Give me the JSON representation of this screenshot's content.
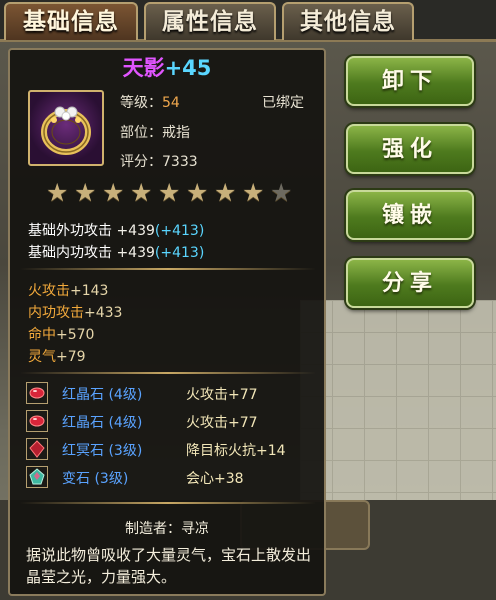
{
  "tabs": [
    {
      "label": "基础信息",
      "active": true
    },
    {
      "label": "属性信息",
      "active": false
    },
    {
      "label": "其他信息",
      "active": false
    }
  ],
  "item": {
    "name_base": "天影",
    "name_plus": "+45",
    "icon": "gold-ring-icon",
    "level_label": "等级：",
    "level_value": "54",
    "bound": "已绑定",
    "slot": "部位：戒指",
    "score": "评分：7333",
    "stars_total": 9,
    "stars_filled": 8
  },
  "base_stats": [
    {
      "label": "基础外功攻击",
      "value": "+439",
      "bonus": "(+413)"
    },
    {
      "label": "基础内功攻击",
      "value": "+439",
      "bonus": "(+413)"
    }
  ],
  "extra_attrs": [
    {
      "label": "火攻击",
      "value": "+143"
    },
    {
      "label": "内功攻击",
      "value": "+433"
    },
    {
      "label": "命中",
      "value": "+570"
    },
    {
      "label": "灵气",
      "value": "+79"
    }
  ],
  "gems": [
    {
      "name": "红晶石 (4级)",
      "effect": "火攻击+77",
      "icon": "red-crystal-gem-icon",
      "color": "#d9253a"
    },
    {
      "name": "红晶石 (4级)",
      "effect": "火攻击+77",
      "icon": "red-crystal-gem-icon",
      "color": "#d9253a"
    },
    {
      "name": "红冥石 (3级)",
      "effect": "降目标火抗+14",
      "icon": "red-dark-gem-icon",
      "color": "#b51f2f"
    },
    {
      "name": "变石 (3级)",
      "effect": "会心+38",
      "icon": "teal-gem-icon",
      "color": "#3fb8a0"
    }
  ],
  "maker": "制造者：寻凉",
  "description": "据说此物曾吸收了大量灵气，宝石上散发出晶莹之光，力量强大。",
  "actions": {
    "unequip": "卸下",
    "enhance": "强化",
    "inlay": "镶嵌",
    "share": "分享"
  },
  "colors": {
    "name_purple": "#e055ff",
    "bonus_cyan": "#5ad6ff",
    "attr_orange": "#f2a93b",
    "gem_blue": "#5aa3ff",
    "button_green": "#5a8a24"
  }
}
